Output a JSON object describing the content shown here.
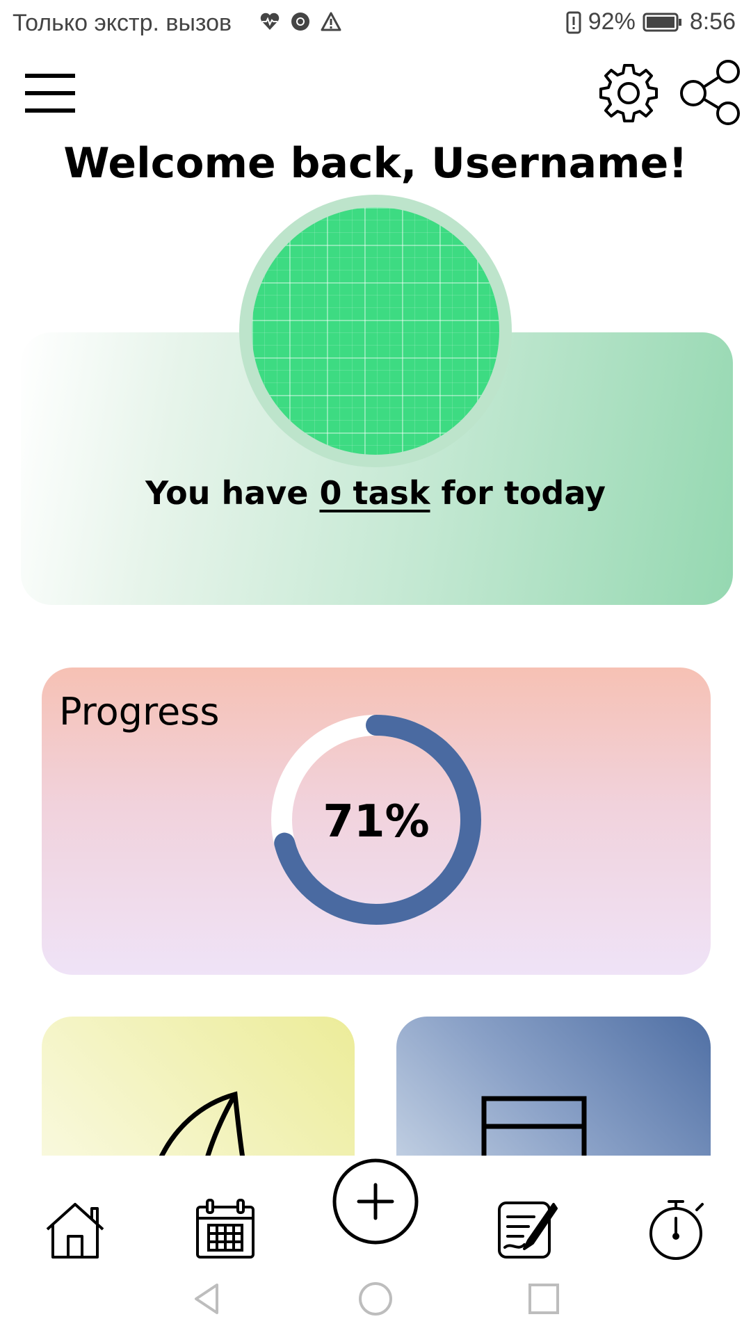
{
  "status_bar": {
    "carrier_text": "Только экстр. вызов",
    "battery_percent": "92%",
    "time": "8:56",
    "icons": [
      "heart-pulse-icon",
      "chrome-icon",
      "warning-icon",
      "battery-alert-icon",
      "battery-icon"
    ]
  },
  "header": {
    "welcome": "Welcome back, Username!"
  },
  "tasks_card": {
    "prefix": "You have ",
    "link": "0 task",
    "suffix": " for today"
  },
  "progress_card": {
    "title": "Progress",
    "value_text": "71%",
    "value": 0.71,
    "track_color": "#ffffff",
    "fill_color": "#4a6aa1"
  },
  "bottom_nav": {
    "items": [
      "home-icon",
      "calendar-icon",
      "add-icon",
      "notes-icon",
      "timer-icon"
    ]
  },
  "colors": {
    "accent_green": "#3ddb82",
    "progress_blue": "#4a6aa1"
  }
}
